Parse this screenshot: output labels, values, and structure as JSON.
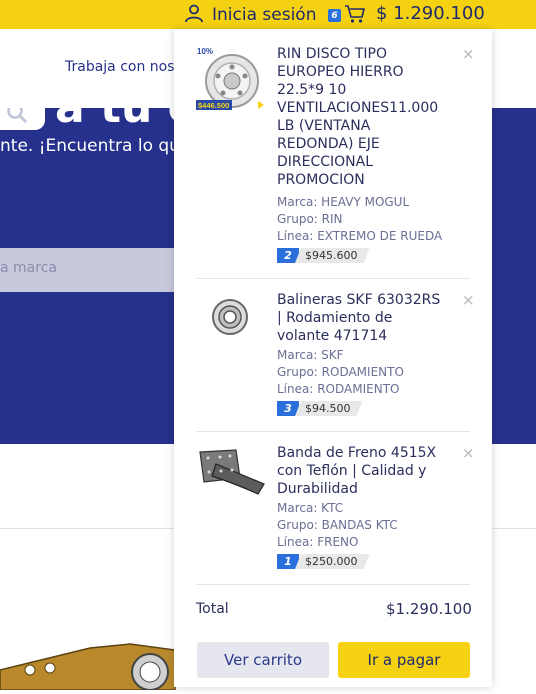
{
  "topbar": {
    "login_label": "Inicia sesión",
    "cart_count": "6",
    "cart_total": "$ 1.290.100"
  },
  "page": {
    "nav_link": "Trabaja con noso",
    "hero_big": "a tu e",
    "hero_subtitle": "nte. ¡Encuentra lo que",
    "search_placeholder": "a marca"
  },
  "cart": {
    "items": [
      {
        "title": "RIN DISCO TIPO EUROPEO HIERRO 22.5*9 10 VENTILACIONES11.000 LB (VENTANA REDONDA) EJE DIRECCIONAL PROMOCION",
        "brand": "Marca: HEAVY MOGUL",
        "group": "Grupo: RIN",
        "line": "Línea: EXTREMO DE RUEDA",
        "qty": "2",
        "price": "$945.600",
        "promo_discount": "10%",
        "promo_price": "$446.500",
        "image_icon": "rim-image"
      },
      {
        "title": "Balineras SKF 63032RS | Rodamiento de volante 471714",
        "brand": "Marca: SKF",
        "group": "Grupo: RODAMIENTO",
        "line": "Línea: RODAMIENTO",
        "qty": "3",
        "price": "$94.500",
        "image_icon": "bearing-image"
      },
      {
        "title": "Banda de Freno 4515X con Teflón | Calidad y Durabilidad",
        "brand": "Marca: KTC",
        "group": "Grupo: BANDAS KTC",
        "line": "Línea: FRENO",
        "qty": "1",
        "price": "$250.000",
        "image_icon": "brake-band-image"
      }
    ],
    "remove_symbol": "×",
    "total_label": "Total",
    "total_value": "$1.290.100",
    "view_cart_label": "Ver carrito",
    "checkout_label": "Ir a pagar"
  },
  "colors": {
    "brand_yellow": "#f5d211",
    "brand_navy": "#25318c",
    "qty_blue": "#2a6fdc"
  }
}
